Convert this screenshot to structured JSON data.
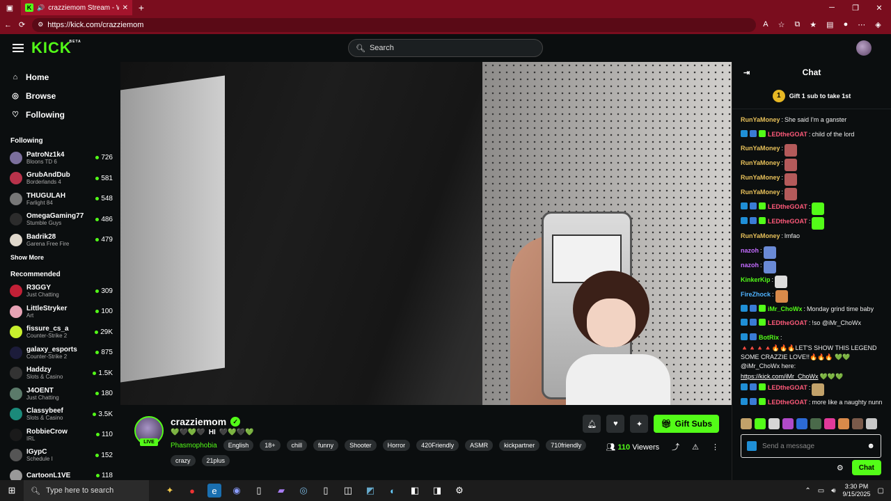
{
  "browser": {
    "tab_title": "crazziemom Stream - Watch",
    "tab_favicon": "K",
    "url": "https://kick.com/crazziemom"
  },
  "header": {
    "logo": "KICK",
    "logo_badge": "BETA",
    "search_placeholder": "Search"
  },
  "sidebar": {
    "nav": [
      {
        "label": "Home",
        "icon": "home-icon"
      },
      {
        "label": "Browse",
        "icon": "compass-icon"
      },
      {
        "label": "Following",
        "icon": "heart-icon"
      }
    ],
    "following_title": "Following",
    "following": [
      {
        "name": "PatroNz1k4",
        "game": "Bloons TD 6",
        "viewers": "726",
        "color": "#7b6f9c"
      },
      {
        "name": "GrubAndDub",
        "game": "Borderlands 4",
        "viewers": "581",
        "color": "#b8324a"
      },
      {
        "name": "THUGULAH",
        "game": "Farlight 84",
        "viewers": "548",
        "color": "#777777"
      },
      {
        "name": "OmegaGaming77",
        "game": "Stumble Guys",
        "viewers": "486",
        "color": "#2c2c2c"
      },
      {
        "name": "Badrik28",
        "game": "Garena Free Fire",
        "viewers": "479",
        "color": "#e0d8cc"
      }
    ],
    "show_more": "Show More",
    "recommended_title": "Recommended",
    "recommended": [
      {
        "name": "R3GGY",
        "game": "Just Chatting",
        "viewers": "309",
        "color": "#c22036"
      },
      {
        "name": "LittleStryker",
        "game": "Art",
        "viewers": "100",
        "color": "#e7a3b5"
      },
      {
        "name": "fissure_cs_a",
        "game": "Counter-Strike 2",
        "viewers": "29K",
        "color": "#c7ef2d"
      },
      {
        "name": "galaxy_esports",
        "game": "Counter-Strike 2",
        "viewers": "875",
        "color": "#1c1c3a"
      },
      {
        "name": "Haddzy",
        "game": "Slots & Casino",
        "viewers": "1.5K",
        "color": "#333333"
      },
      {
        "name": "J4OENT",
        "game": "Just Chatting",
        "viewers": "180",
        "color": "#5b7a6a"
      },
      {
        "name": "Classybeef",
        "game": "Slots & Casino",
        "viewers": "3.5K",
        "color": "#1b8a7a"
      },
      {
        "name": "RobbieCrow",
        "game": "IRL",
        "viewers": "110",
        "color": "#1a1a1a"
      },
      {
        "name": "IGypC",
        "game": "Schedule I",
        "viewers": "152",
        "color": "#555555"
      },
      {
        "name": "CartoonL1VE",
        "game": "",
        "viewers": "118",
        "color": "#999999"
      }
    ]
  },
  "stream": {
    "streamer": "crazziemom",
    "live_label": "LIVE",
    "title_text": "HI",
    "category": "Phasmophobia",
    "tags": [
      "English",
      "18+",
      "chill",
      "funny",
      "Shooter",
      "Horror",
      "420Friendly",
      "ASMR",
      "kickpartner",
      "710friendly",
      "crazy",
      "21plus"
    ],
    "viewer_count": "110",
    "viewer_label": "Viewers",
    "gift_subs_label": "Gift Subs"
  },
  "chat": {
    "title": "Chat",
    "gift_banner": "Gift 1 sub to take 1st",
    "gift_banner_coin": "1",
    "messages": [
      {
        "user": "RunYaMoney",
        "color": "#e8c15a",
        "text": "She said I'm a ganster",
        "badges": 0,
        "emote": ""
      },
      {
        "user": "LEDtheGOAT",
        "color": "#ff5a7a",
        "text": "child of the lord",
        "badges": 3,
        "emote": ""
      },
      {
        "user": "RunYaMoney",
        "color": "#e8c15a",
        "text": "",
        "badges": 0,
        "emote": "#b45a5a"
      },
      {
        "user": "RunYaMoney",
        "color": "#e8c15a",
        "text": "",
        "badges": 0,
        "emote": "#b45a5a"
      },
      {
        "user": "RunYaMoney",
        "color": "#e8c15a",
        "text": "",
        "badges": 0,
        "emote": "#b45a5a"
      },
      {
        "user": "RunYaMoney",
        "color": "#e8c15a",
        "text": "",
        "badges": 0,
        "emote": "#b45a5a"
      },
      {
        "user": "LEDtheGOAT",
        "color": "#ff5a7a",
        "text": "",
        "badges": 3,
        "emote": "#53fc18"
      },
      {
        "user": "LEDtheGOAT",
        "color": "#ff5a7a",
        "text": "",
        "badges": 3,
        "emote": "#53fc18"
      },
      {
        "user": "RunYaMoney",
        "color": "#e8c15a",
        "text": "lmfao",
        "badges": 0,
        "emote": ""
      },
      {
        "user": "nazoh",
        "color": "#c36bff",
        "text": "",
        "badges": 0,
        "emote": "#6a8ad6"
      },
      {
        "user": "nazoh",
        "color": "#c36bff",
        "text": "",
        "badges": 0,
        "emote": "#6a8ad6"
      },
      {
        "user": "KinkerKip",
        "color": "#53fc18",
        "text": "",
        "badges": 0,
        "emote": "#dddddd"
      },
      {
        "user": "FireZhock",
        "color": "#4fb3ff",
        "text": "",
        "badges": 0,
        "emote": "#d98a4a"
      },
      {
        "user": "iMr_ChoWx",
        "color": "#53fc18",
        "text": "Monday grind time baby",
        "badges": 3,
        "emote": ""
      },
      {
        "user": "LEDtheGOAT",
        "color": "#ff5a7a",
        "text": "!so @iMr_ChoWx",
        "badges": 3,
        "emote": ""
      },
      {
        "user": "BotRix",
        "color": "#53fc18",
        "text": "🔺🔺🔺🔺🔥🔥🔥LET'S SHOW THIS LEGEND SOME CRAZZIE LOVE!!🔥🔥🔥 💚💚 @iMr_ChoWx here:",
        "badges": 2,
        "emote": "",
        "link": "https://kick.com/iMr_ChoWx",
        "after": "💚💚💚"
      },
      {
        "user": "LEDtheGOAT",
        "color": "#ff5a7a",
        "text": "",
        "badges": 3,
        "emote": "#c2a26a"
      },
      {
        "user": "LEDtheGOAT",
        "color": "#ff5a7a",
        "text": "more like a naughty nunn",
        "badges": 3,
        "emote": ""
      }
    ],
    "input_placeholder": "Send a message",
    "send_label": "Chat"
  },
  "taskbar": {
    "search_placeholder": "Type here to search",
    "time": "3:30 PM",
    "date": "9/15/2025"
  }
}
